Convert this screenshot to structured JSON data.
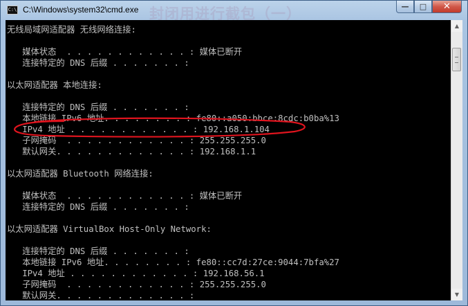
{
  "window": {
    "title": "C:\\Windows\\system32\\cmd.exe",
    "icon_text": "C:\\",
    "watermark": "封闭用进行截包（一）",
    "buttons": {
      "minimize_glyph": "—",
      "maximize_glyph": "□",
      "close_glyph": "✕"
    }
  },
  "console": {
    "lines": [
      "无线局域网适配器 无线网络连接:",
      "",
      "   媒体状态  . . . . . . . . . . . . : 媒体已断开",
      "   连接特定的 DNS 后缀 . . . . . . . :",
      "",
      "以太网适配器 本地连接:",
      "",
      "   连接特定的 DNS 后缀 . . . . . . . :",
      "   本地链接 IPv6 地址. . . . . . . . : fe80::a050:bbce:8cdc:b0ba%13",
      "   IPv4 地址 . . . . . . . . . . . . : 192.168.1.104",
      "   子网掩码  . . . . . . . . . . . . : 255.255.255.0",
      "   默认网关. . . . . . . . . . . . . : 192.168.1.1",
      "",
      "以太网适配器 Bluetooth 网络连接:",
      "",
      "   媒体状态  . . . . . . . . . . . . : 媒体已断开",
      "   连接特定的 DNS 后缀 . . . . . . . :",
      "",
      "以太网适配器 VirtualBox Host-Only Network:",
      "",
      "   连接特定的 DNS 后缀 . . . . . . . :",
      "   本地链接 IPv6 地址. . . . . . . . : fe80::cc7d:27ce:9044:7bfa%27",
      "   IPv4 地址 . . . . . . . . . . . . : 192.168.56.1",
      "   子网掩码  . . . . . . . . . . . . : 255.255.255.0",
      "   默认网关. . . . . . . . . . . . . :"
    ]
  },
  "scrollbar": {
    "up_glyph": "▲",
    "down_glyph": "▼"
  },
  "colors": {
    "console_bg": "#000000",
    "console_text": "#c0c0c0",
    "annotation": "#e0141e"
  }
}
